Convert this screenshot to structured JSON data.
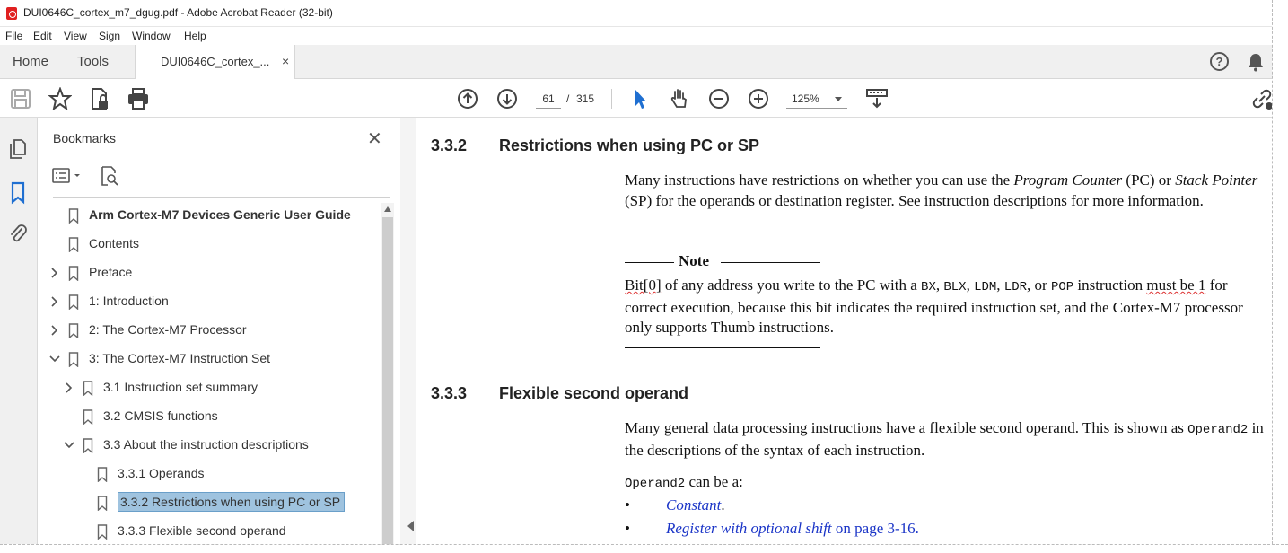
{
  "window": {
    "title": "DUI0646C_cortex_m7_dgug.pdf - Adobe Acrobat Reader (32-bit)"
  },
  "menu": [
    "File",
    "Edit",
    "View",
    "Sign",
    "Window",
    "Help"
  ],
  "tabs": {
    "home": "Home",
    "tools": "Tools",
    "document": "DUI0646C_cortex_...",
    "close": "×"
  },
  "toolbar": {
    "page_current": "61",
    "page_separator": "/",
    "page_total": "315",
    "zoom": "125%"
  },
  "bookmarks": {
    "title": "Bookmarks",
    "close": "✕",
    "items": [
      {
        "label": "Arm Cortex-M7 Devices Generic User Guide",
        "level": 0,
        "expander": "none",
        "bold": true
      },
      {
        "label": "Contents",
        "level": 0,
        "expander": "none"
      },
      {
        "label": "Preface",
        "level": 0,
        "expander": "collapsed"
      },
      {
        "label": "1: Introduction",
        "level": 0,
        "expander": "collapsed"
      },
      {
        "label": "2: The Cortex-M7 Processor",
        "level": 0,
        "expander": "collapsed"
      },
      {
        "label": "3: The Cortex-M7 Instruction Set",
        "level": 0,
        "expander": "expanded"
      },
      {
        "label": "3.1 Instruction set summary",
        "level": 1,
        "expander": "collapsed"
      },
      {
        "label": "3.2 CMSIS functions",
        "level": 1,
        "expander": "none"
      },
      {
        "label": "3.3 About the instruction descriptions",
        "level": 1,
        "expander": "expanded"
      },
      {
        "label": "3.3.1 Operands",
        "level": 2,
        "expander": "none"
      },
      {
        "label": "3.3.2 Restrictions when using PC or SP",
        "level": 2,
        "expander": "none",
        "selected": true
      },
      {
        "label": "3.3.3 Flexible second operand",
        "level": 2,
        "expander": "none"
      }
    ]
  },
  "document": {
    "section1": {
      "number": "3.3.2",
      "title": "Restrictions when using PC or SP",
      "para_parts": {
        "a": "Many instructions have restrictions on whether you can use the ",
        "b": "Program Counter",
        "c": " (PC) or ",
        "d": "Stack Pointer",
        "e": " (SP) for the operands or destination register. See instruction descriptions for more information."
      },
      "note_label": "Note",
      "note_parts": {
        "bit": "Bit[0]",
        "t1": " of any address you write to the PC with a ",
        "bx": "BX",
        "c1": ", ",
        "blx": "BLX",
        "c2": ", ",
        "ldm": "LDM",
        "c3": ", ",
        "ldr": "LDR",
        "c4": ", or ",
        "pop": "POP",
        "t2": " instruction ",
        "must": "must be 1",
        "t3": " for correct execution, because this bit indicates the required instruction set, and the Cortex-M7 processor only supports Thumb instructions."
      }
    },
    "section2": {
      "number": "3.3.3",
      "title": "Flexible second operand",
      "para_parts": {
        "a": "Many general data processing instructions have a flexible second operand. This is shown as ",
        "op2": "Operand2",
        "b": " in the descriptions of the syntax of each instruction."
      },
      "can_be": {
        "op2": "Operand2",
        "text": " can be a:"
      },
      "bullets": [
        {
          "bullet": "•",
          "link": "Constant",
          "rest": "."
        },
        {
          "bullet": "•",
          "link": "Register with optional shift",
          "rest": " on page 3-16."
        }
      ]
    }
  }
}
